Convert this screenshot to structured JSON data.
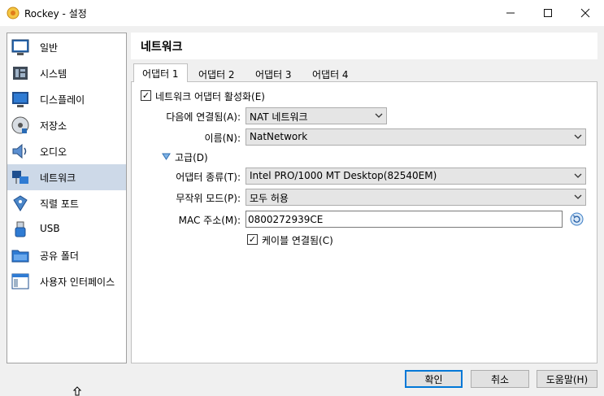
{
  "window": {
    "title": "Rockey - 설정",
    "minimize_glyph": "—",
    "maximize_glyph": "☐",
    "close_glyph": "✕"
  },
  "sidebar": {
    "items": [
      {
        "label": "일반",
        "icon": "general-icon"
      },
      {
        "label": "시스템",
        "icon": "system-icon"
      },
      {
        "label": "디스플레이",
        "icon": "display-icon"
      },
      {
        "label": "저장소",
        "icon": "storage-icon"
      },
      {
        "label": "오디오",
        "icon": "audio-icon"
      },
      {
        "label": "네트워크",
        "icon": "network-icon",
        "selected": true
      },
      {
        "label": "직렬 포트",
        "icon": "serial-port-icon"
      },
      {
        "label": "USB",
        "icon": "usb-icon"
      },
      {
        "label": "공유 폴더",
        "icon": "shared-folder-icon"
      },
      {
        "label": "사용자 인터페이스",
        "icon": "user-interface-icon"
      }
    ]
  },
  "panel": {
    "title": "네트워크",
    "tabs": [
      "어댑터 1",
      "어댑터 2",
      "어댑터 3",
      "어댑터 4"
    ],
    "active_tab": 0,
    "enable_adapter": {
      "label": "네트워크 어댑터 활성화(E)",
      "checked": true
    },
    "attached_to": {
      "label": "다음에 연결됨(A):",
      "value": "NAT 네트워크"
    },
    "name": {
      "label": "이름(N):",
      "value": "NatNetwork"
    },
    "advanced": {
      "label": "고급(D)",
      "expanded": true
    },
    "adapter_type": {
      "label": "어댑터 종류(T):",
      "value": "Intel PRO/1000 MT Desktop(82540EM)"
    },
    "promiscuous": {
      "label": "무작위 모드(P):",
      "value": "모두 허용"
    },
    "mac": {
      "label": "MAC 주소(M):",
      "value": "0800272939CE"
    },
    "cable": {
      "label": "케이블 연결됨(C)",
      "checked": true
    }
  },
  "footer": {
    "ok": "확인",
    "cancel": "취소",
    "help": "도움말(H)"
  },
  "colors": {
    "selected_bg": "#cdd9e8",
    "accent": "#0078d7"
  }
}
